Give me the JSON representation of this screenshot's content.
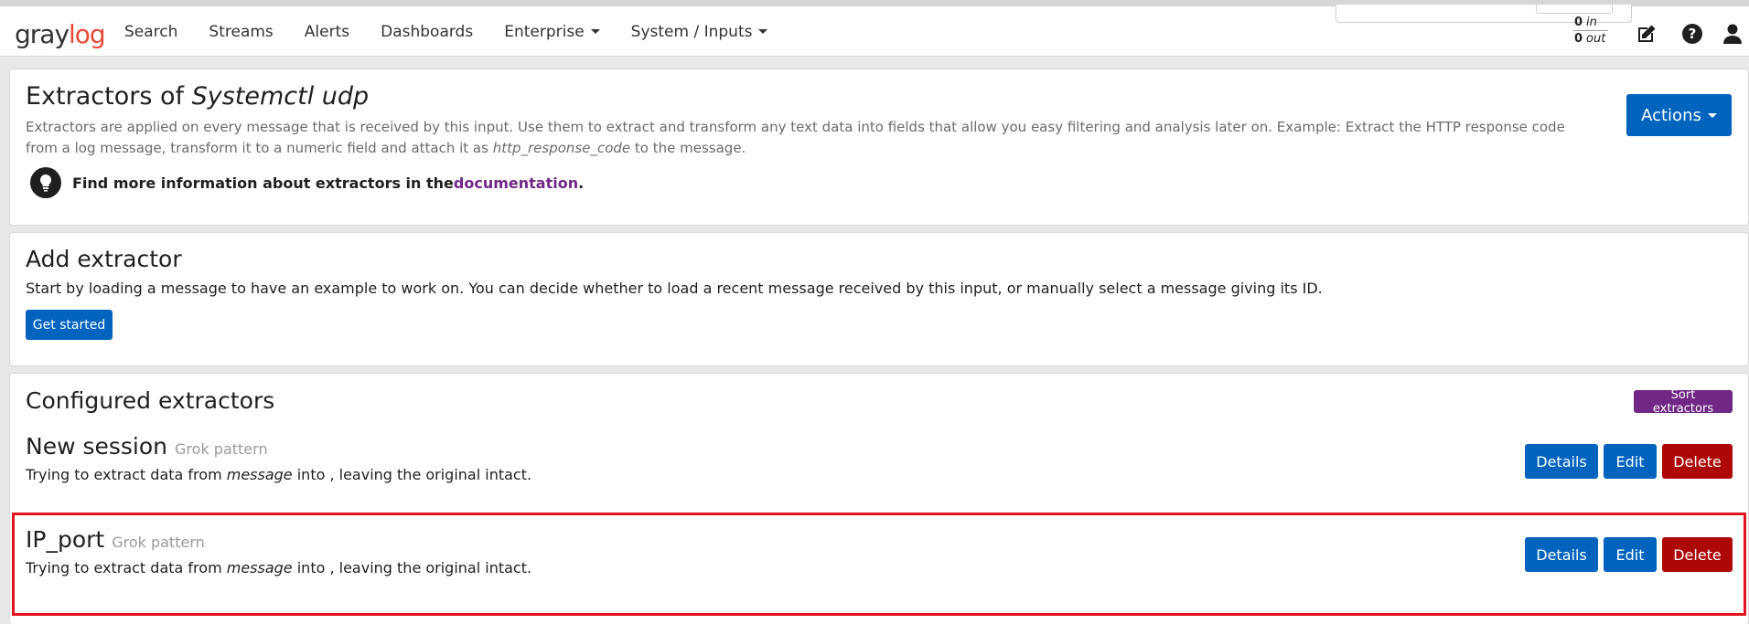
{
  "navbar": {
    "logo": {
      "part1": "gray",
      "part2": "log"
    },
    "items": [
      {
        "label": "Search",
        "dropdown": false
      },
      {
        "label": "Streams",
        "dropdown": false
      },
      {
        "label": "Alerts",
        "dropdown": false
      },
      {
        "label": "Dashboards",
        "dropdown": false
      },
      {
        "label": "Enterprise",
        "dropdown": true
      },
      {
        "label": "System / Inputs",
        "dropdown": true
      }
    ],
    "throughput": {
      "in_value": "0",
      "in_label": "in",
      "out_value": "0",
      "out_label": "out"
    },
    "icons": [
      "edit-icon",
      "help-icon",
      "user-icon"
    ]
  },
  "header": {
    "title_prefix": "Extractors of ",
    "input_name": "Systemctl udp",
    "description_part1": "Extractors are applied on every message that is received by this input. Use them to extract and transform any text data into fields that allow you easy filtering and analysis later on. Example: Extract the HTTP response code from a log message, transform it to a numeric field and attach it as ",
    "description_field": "http_response_code",
    "description_part2": " to the message.",
    "info_text": "Find more information about extractors in the ",
    "info_link": "documentation",
    "info_suffix": ".",
    "actions_label": "Actions"
  },
  "add_extractor": {
    "title": "Add extractor",
    "description": "Start by loading a message to have an example to work on. You can decide whether to load a recent message received by this input, or manually select a message giving its ID.",
    "button_label": "Get started"
  },
  "configured": {
    "title": "Configured extractors",
    "sort_label": "Sort extractors",
    "extractors": [
      {
        "name": "New session",
        "type": "Grok pattern",
        "desc_prefix": "Trying to extract data from ",
        "desc_field": "message",
        "desc_suffix": " into , leaving the original intact.",
        "details_label": "Details",
        "edit_label": "Edit",
        "delete_label": "Delete"
      },
      {
        "name": "IP_port",
        "type": "Grok pattern",
        "desc_prefix": "Trying to extract data from ",
        "desc_field": "message",
        "desc_suffix": " into , leaving the original intact.",
        "details_label": "Details",
        "edit_label": "Edit",
        "delete_label": "Delete"
      }
    ]
  },
  "colors": {
    "primary": "#0063be",
    "danger": "#ad0707",
    "purple": "#702785",
    "highlight": "#e1141e",
    "logo_red": "#e64a37"
  }
}
